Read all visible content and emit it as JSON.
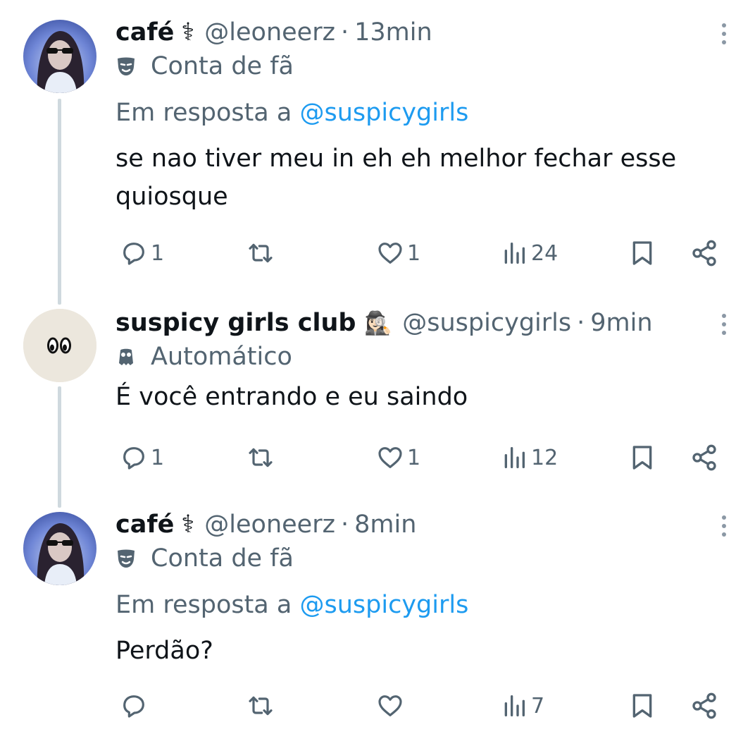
{
  "tweets": [
    {
      "name": "café",
      "name_symbol": "⚕",
      "handle": "@leoneerz",
      "separator": "·",
      "time": "13min",
      "label": "Conta de fã",
      "label_icon": "mask-icon",
      "reply_prefix": "Em resposta a",
      "reply_to": "@suspicygirls",
      "text": "se nao tiver meu in eh eh melhor fechar esse quiosque",
      "replies": "1",
      "retweets": "",
      "likes": "1",
      "views": "24"
    },
    {
      "name": "suspicy girls club",
      "name_symbol": "🕵🏻‍♀️",
      "handle": "@suspicygirls",
      "separator": "·",
      "time": "9min",
      "label": "Automático",
      "label_icon": "bot-icon",
      "text": "É você entrando e eu saindo",
      "replies": "1",
      "retweets": "",
      "likes": "1",
      "views": "12"
    },
    {
      "name": "café",
      "name_symbol": "⚕",
      "handle": "@leoneerz",
      "separator": "·",
      "time": "8min",
      "label": "Conta de fã",
      "label_icon": "mask-icon",
      "reply_prefix": "Em resposta a",
      "reply_to": "@suspicygirls",
      "text": "Perdão?",
      "replies": "",
      "retweets": "",
      "likes": "",
      "views": "7"
    }
  ],
  "colors": {
    "text": "#0f1419",
    "secondary": "#536471",
    "link": "#1d9bf0",
    "thread_line": "#cfd9de"
  }
}
